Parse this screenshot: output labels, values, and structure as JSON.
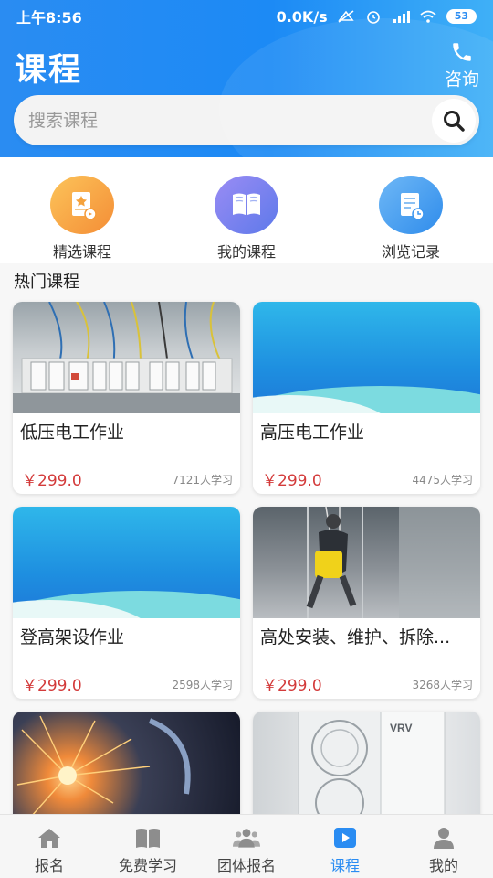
{
  "status_bar": {
    "time": "上午8:56",
    "network_speed": "0.0K/s",
    "battery": "53"
  },
  "header": {
    "title": "课程",
    "consult_label": "咨询"
  },
  "search": {
    "placeholder": "搜索课程"
  },
  "shortcuts": [
    {
      "label": "精选课程",
      "icon": "star-certificate-icon",
      "color": "#f7a440"
    },
    {
      "label": "我的课程",
      "icon": "open-book-icon",
      "color": "#7b7ff0"
    },
    {
      "label": "浏览记录",
      "icon": "history-document-icon",
      "color": "#3d97f0"
    }
  ],
  "section": {
    "title": "热门课程"
  },
  "courses": [
    {
      "name": "低压电工作业",
      "price": "￥299.0",
      "learners": "7121人学习"
    },
    {
      "name": "高压电工作业",
      "price": "￥299.0",
      "learners": "4475人学习"
    },
    {
      "name": "登高架设作业",
      "price": "￥299.0",
      "learners": "2598人学习"
    },
    {
      "name": "高处安装、维护、拆除...",
      "price": "￥299.0",
      "learners": "3268人学习"
    }
  ],
  "tabbar": [
    {
      "label": "报名",
      "icon": "home-icon",
      "active": false
    },
    {
      "label": "免费学习",
      "icon": "book-icon",
      "active": false
    },
    {
      "label": "团体报名",
      "icon": "group-icon",
      "active": false
    },
    {
      "label": "课程",
      "icon": "play-icon",
      "active": true
    },
    {
      "label": "我的",
      "icon": "user-icon",
      "active": false
    }
  ],
  "colors": {
    "accent": "#2a8cf2",
    "price": "#d33a3a"
  }
}
